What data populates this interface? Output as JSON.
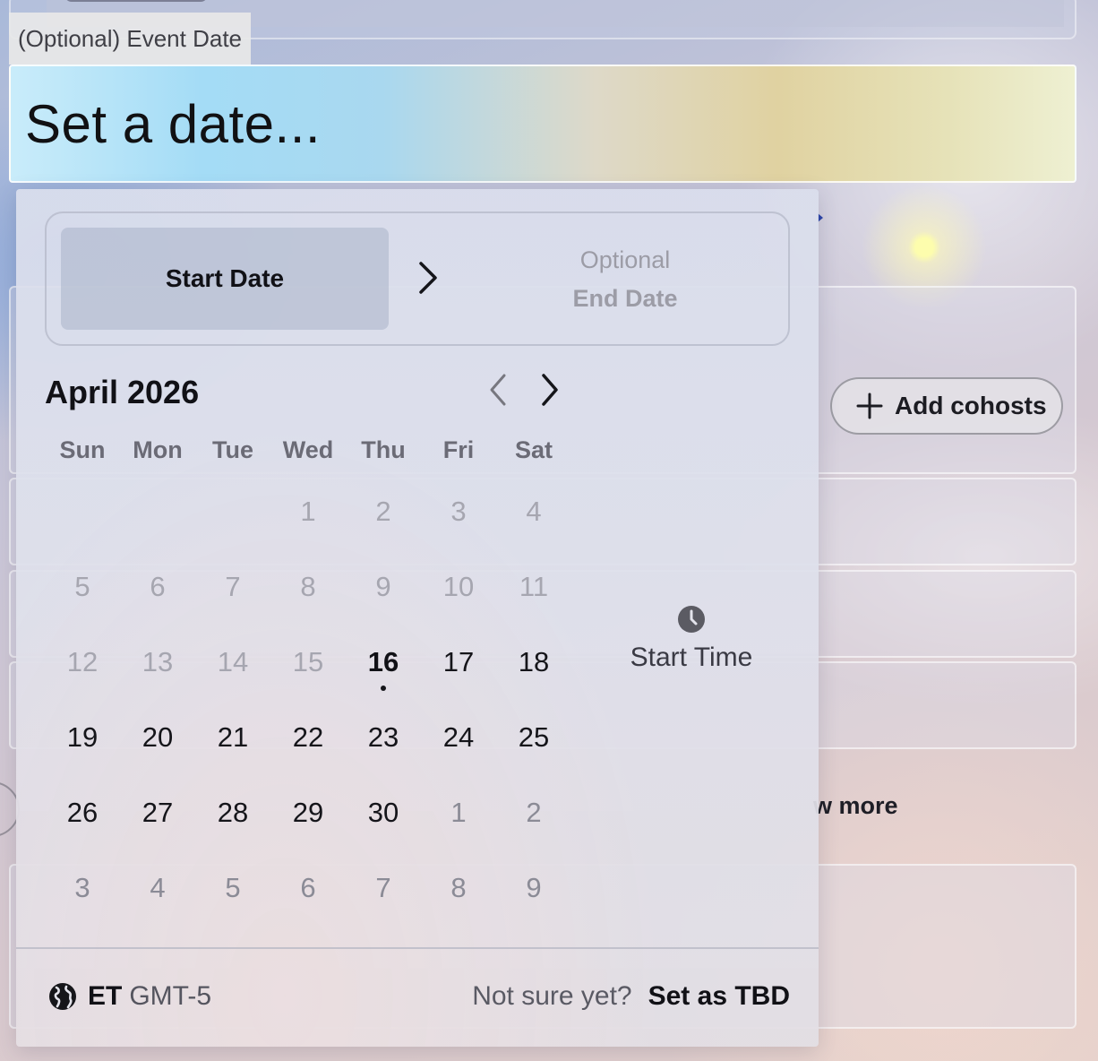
{
  "field": {
    "label": "(Optional) Event Date",
    "placeholder": "Set a date..."
  },
  "background": {
    "add_cohosts_label": "Add cohosts",
    "show_more_fragment": "w more"
  },
  "range": {
    "start_label": "Start Date",
    "end_hint": "Optional",
    "end_label": "End Date"
  },
  "calendar": {
    "month_title": "April 2026",
    "weekdays": [
      "Sun",
      "Mon",
      "Tue",
      "Wed",
      "Thu",
      "Fri",
      "Sat"
    ],
    "weeks": [
      [
        {
          "d": ""
        },
        {
          "d": ""
        },
        {
          "d": ""
        },
        {
          "d": "1",
          "s": "disabled"
        },
        {
          "d": "2",
          "s": "disabled"
        },
        {
          "d": "3",
          "s": "disabled"
        },
        {
          "d": "4",
          "s": "disabled"
        }
      ],
      [
        {
          "d": "5",
          "s": "disabled"
        },
        {
          "d": "6",
          "s": "disabled"
        },
        {
          "d": "7",
          "s": "disabled"
        },
        {
          "d": "8",
          "s": "disabled"
        },
        {
          "d": "9",
          "s": "disabled"
        },
        {
          "d": "10",
          "s": "disabled"
        },
        {
          "d": "11",
          "s": "disabled"
        }
      ],
      [
        {
          "d": "12",
          "s": "disabled"
        },
        {
          "d": "13",
          "s": "disabled"
        },
        {
          "d": "14",
          "s": "disabled"
        },
        {
          "d": "15",
          "s": "disabled"
        },
        {
          "d": "16",
          "s": "today"
        },
        {
          "d": "17",
          "s": "active"
        },
        {
          "d": "18",
          "s": "active"
        }
      ],
      [
        {
          "d": "19",
          "s": "active"
        },
        {
          "d": "20",
          "s": "active"
        },
        {
          "d": "21",
          "s": "active"
        },
        {
          "d": "22",
          "s": "active"
        },
        {
          "d": "23",
          "s": "active"
        },
        {
          "d": "24",
          "s": "active"
        },
        {
          "d": "25",
          "s": "active"
        }
      ],
      [
        {
          "d": "26",
          "s": "active"
        },
        {
          "d": "27",
          "s": "active"
        },
        {
          "d": "28",
          "s": "active"
        },
        {
          "d": "29",
          "s": "active"
        },
        {
          "d": "30",
          "s": "active"
        },
        {
          "d": "1",
          "s": "outside"
        },
        {
          "d": "2",
          "s": "outside"
        }
      ],
      [
        {
          "d": "3",
          "s": "outside"
        },
        {
          "d": "4",
          "s": "outside"
        },
        {
          "d": "5",
          "s": "outside"
        },
        {
          "d": "6",
          "s": "outside"
        },
        {
          "d": "7",
          "s": "outside"
        },
        {
          "d": "8",
          "s": "outside"
        },
        {
          "d": "9",
          "s": "outside"
        }
      ]
    ]
  },
  "time": {
    "start_time_label": "Start Time",
    "icon": "clock-icon"
  },
  "footer": {
    "timezone_abbr": "ET",
    "timezone_offset": "GMT-5",
    "tbd_question": "Not sure yet?",
    "tbd_action": "Set as TBD",
    "icon": "globe-icon"
  }
}
